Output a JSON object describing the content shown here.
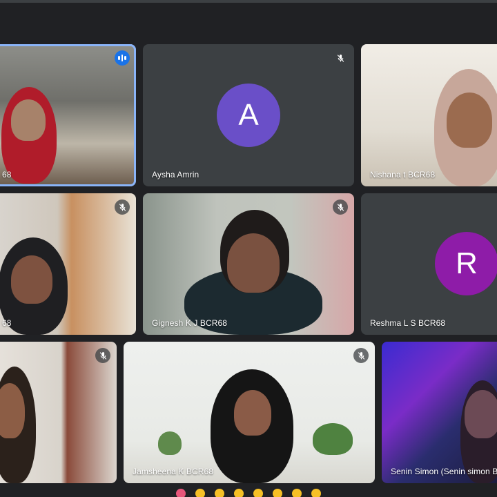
{
  "colors": {
    "page_bg": "#202124",
    "tile_bg": "#3c4043",
    "active_border": "#8ab4f8",
    "speaking_badge": "#1a73e8",
    "avatar_aysha": "#6a4fc8",
    "avatar_reshma": "#8e1ca8"
  },
  "participants": [
    {
      "name": "68",
      "muted": false,
      "speaking": true,
      "icon": "speaking-indicator-icon"
    },
    {
      "name": "Aysha Amrin",
      "initial": "A",
      "muted": true,
      "icon": "mic-off-icon"
    },
    {
      "name": "Nishana t BCR68",
      "muted": false
    },
    {
      "name": "68",
      "muted": true,
      "icon": "mic-off-icon"
    },
    {
      "name": "Gignesh K J BCR68",
      "muted": true,
      "icon": "mic-off-icon"
    },
    {
      "name": "Reshma L S BCR68",
      "initial": "R",
      "muted": false
    },
    {
      "name": "",
      "muted": true,
      "icon": "mic-off-icon"
    },
    {
      "name": "Jamsheena K BCR68",
      "muted": true,
      "icon": "mic-off-icon"
    },
    {
      "name": "Senin Simon (Senin simon BC",
      "muted": false
    }
  ],
  "reactions_bar": {
    "icons": [
      "heart-emoji-icon",
      "emoji-icon",
      "emoji-icon",
      "emoji-icon",
      "emoji-icon",
      "emoji-icon",
      "emoji-icon",
      "emoji-icon"
    ]
  }
}
